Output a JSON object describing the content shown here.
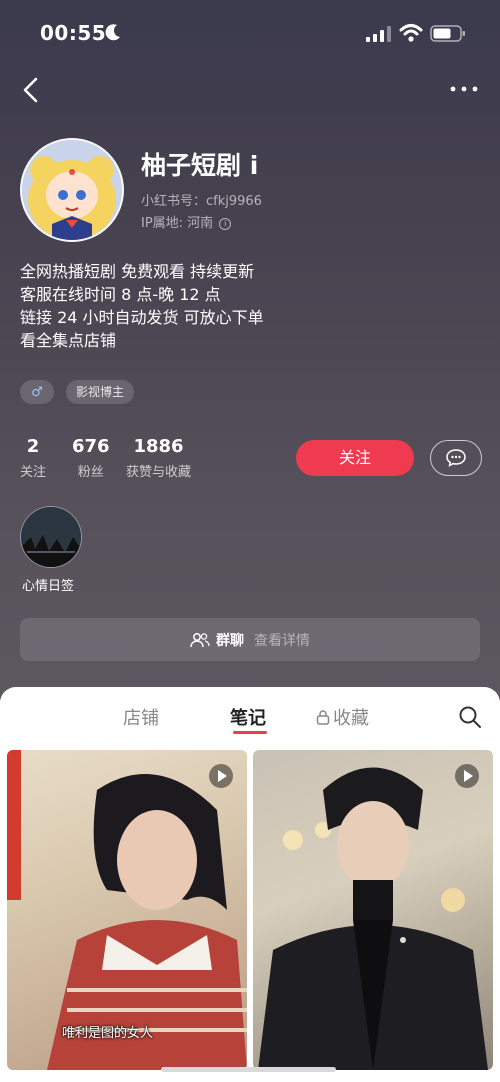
{
  "status_bar": {
    "time": "00:55"
  },
  "profile": {
    "name": "柚子短剧 i",
    "user_id": "小红书号：cfkj9966",
    "ip": "IP属地: 河南",
    "bio": [
      "全网热播短剧 免费观看 持续更新",
      "客服在线时间 8 点-晚 12 点",
      "链接 24 小时自动发货 可放心下单",
      "看全集点店铺"
    ],
    "tags": {
      "gender_symbol": "♂",
      "category": "影视博主"
    }
  },
  "stats": [
    {
      "num": "2",
      "label": "关注"
    },
    {
      "num": "676",
      "label": "粉丝"
    },
    {
      "num": "1886",
      "label": "获赞与收藏"
    }
  ],
  "actions": {
    "follow": "关注"
  },
  "collection": {
    "label": "心情日签"
  },
  "group": {
    "title": "群聊",
    "detail": "查看详情"
  },
  "tabs": [
    {
      "label": "店铺"
    },
    {
      "label": "笔记",
      "active": true
    },
    {
      "label": "收藏",
      "locked": true
    }
  ],
  "notes": [
    {
      "caption": "唯利是图的女人"
    }
  ],
  "colors": {
    "accent": "#ee3b4f",
    "hero_bg": "#47424f"
  }
}
